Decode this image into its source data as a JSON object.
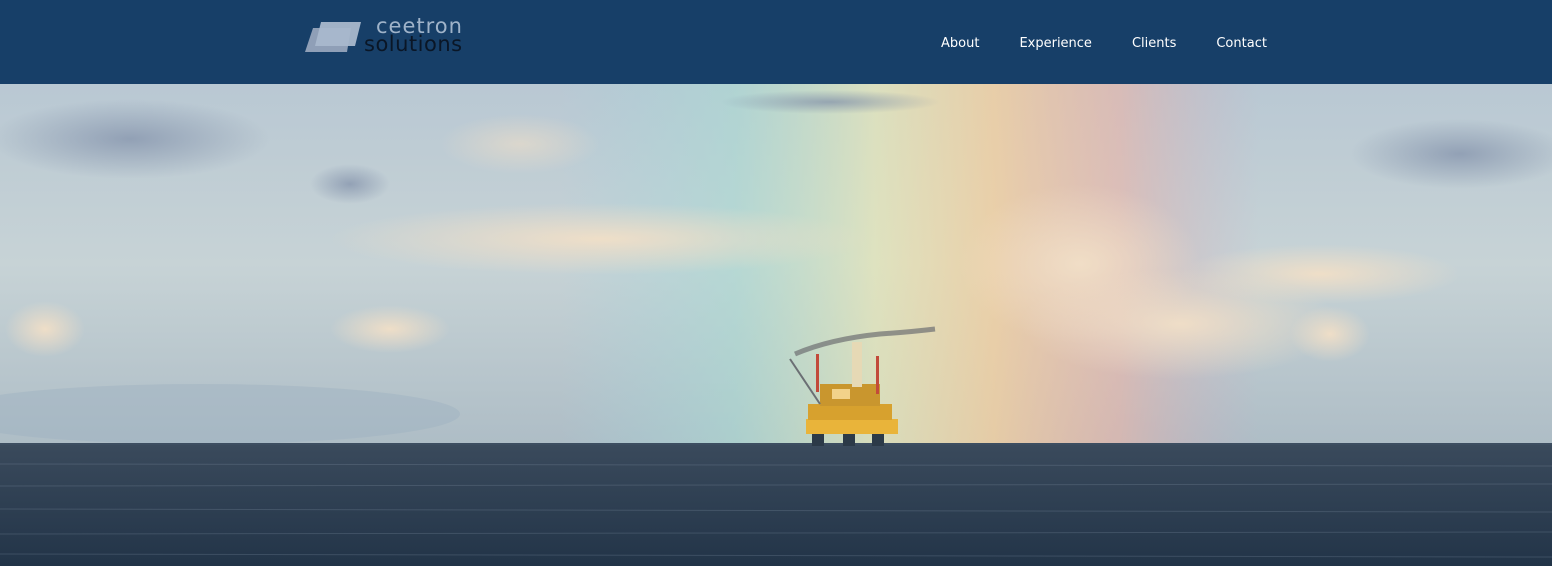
{
  "header": {
    "logo": {
      "line1": "ceetron",
      "line2": "solutions"
    },
    "nav": [
      {
        "label": "About"
      },
      {
        "label": "Experience"
      },
      {
        "label": "Clients"
      },
      {
        "label": "Contact"
      }
    ]
  },
  "hero": {
    "image": "offshore-oil-platform-on-sea-with-rainbow"
  },
  "colors": {
    "header_bg": "#173f68",
    "logo_light": "#9fb3c9",
    "logo_dark": "#0a1626",
    "sea": "#2a3b4f"
  }
}
